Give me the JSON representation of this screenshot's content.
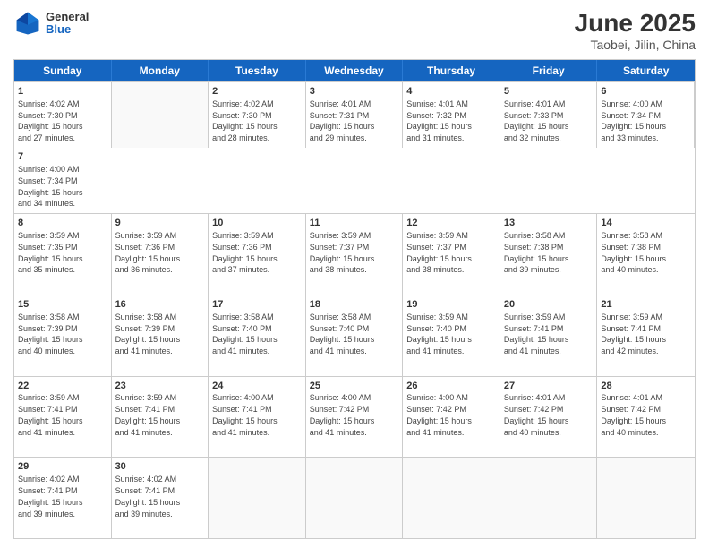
{
  "header": {
    "logo_general": "General",
    "logo_blue": "Blue",
    "month_title": "June 2025",
    "location": "Taobei, Jilin, China"
  },
  "weekdays": [
    "Sunday",
    "Monday",
    "Tuesday",
    "Wednesday",
    "Thursday",
    "Friday",
    "Saturday"
  ],
  "rows": [
    [
      {
        "empty": true
      },
      {
        "day": "2",
        "info": "Sunrise: 4:02 AM\nSunset: 7:30 PM\nDaylight: 15 hours\nand 28 minutes."
      },
      {
        "day": "3",
        "info": "Sunrise: 4:01 AM\nSunset: 7:31 PM\nDaylight: 15 hours\nand 29 minutes."
      },
      {
        "day": "4",
        "info": "Sunrise: 4:01 AM\nSunset: 7:32 PM\nDaylight: 15 hours\nand 31 minutes."
      },
      {
        "day": "5",
        "info": "Sunrise: 4:01 AM\nSunset: 7:33 PM\nDaylight: 15 hours\nand 32 minutes."
      },
      {
        "day": "6",
        "info": "Sunrise: 4:00 AM\nSunset: 7:34 PM\nDaylight: 15 hours\nand 33 minutes."
      },
      {
        "day": "7",
        "info": "Sunrise: 4:00 AM\nSunset: 7:34 PM\nDaylight: 15 hours\nand 34 minutes."
      }
    ],
    [
      {
        "day": "8",
        "info": "Sunrise: 3:59 AM\nSunset: 7:35 PM\nDaylight: 15 hours\nand 35 minutes."
      },
      {
        "day": "9",
        "info": "Sunrise: 3:59 AM\nSunset: 7:36 PM\nDaylight: 15 hours\nand 36 minutes."
      },
      {
        "day": "10",
        "info": "Sunrise: 3:59 AM\nSunset: 7:36 PM\nDaylight: 15 hours\nand 37 minutes."
      },
      {
        "day": "11",
        "info": "Sunrise: 3:59 AM\nSunset: 7:37 PM\nDaylight: 15 hours\nand 38 minutes."
      },
      {
        "day": "12",
        "info": "Sunrise: 3:59 AM\nSunset: 7:37 PM\nDaylight: 15 hours\nand 38 minutes."
      },
      {
        "day": "13",
        "info": "Sunrise: 3:58 AM\nSunset: 7:38 PM\nDaylight: 15 hours\nand 39 minutes."
      },
      {
        "day": "14",
        "info": "Sunrise: 3:58 AM\nSunset: 7:38 PM\nDaylight: 15 hours\nand 40 minutes."
      }
    ],
    [
      {
        "day": "15",
        "info": "Sunrise: 3:58 AM\nSunset: 7:39 PM\nDaylight: 15 hours\nand 40 minutes."
      },
      {
        "day": "16",
        "info": "Sunrise: 3:58 AM\nSunset: 7:39 PM\nDaylight: 15 hours\nand 41 minutes."
      },
      {
        "day": "17",
        "info": "Sunrise: 3:58 AM\nSunset: 7:40 PM\nDaylight: 15 hours\nand 41 minutes."
      },
      {
        "day": "18",
        "info": "Sunrise: 3:58 AM\nSunset: 7:40 PM\nDaylight: 15 hours\nand 41 minutes."
      },
      {
        "day": "19",
        "info": "Sunrise: 3:59 AM\nSunset: 7:40 PM\nDaylight: 15 hours\nand 41 minutes."
      },
      {
        "day": "20",
        "info": "Sunrise: 3:59 AM\nSunset: 7:41 PM\nDaylight: 15 hours\nand 41 minutes."
      },
      {
        "day": "21",
        "info": "Sunrise: 3:59 AM\nSunset: 7:41 PM\nDaylight: 15 hours\nand 42 minutes."
      }
    ],
    [
      {
        "day": "22",
        "info": "Sunrise: 3:59 AM\nSunset: 7:41 PM\nDaylight: 15 hours\nand 41 minutes."
      },
      {
        "day": "23",
        "info": "Sunrise: 3:59 AM\nSunset: 7:41 PM\nDaylight: 15 hours\nand 41 minutes."
      },
      {
        "day": "24",
        "info": "Sunrise: 4:00 AM\nSunset: 7:41 PM\nDaylight: 15 hours\nand 41 minutes."
      },
      {
        "day": "25",
        "info": "Sunrise: 4:00 AM\nSunset: 7:42 PM\nDaylight: 15 hours\nand 41 minutes."
      },
      {
        "day": "26",
        "info": "Sunrise: 4:00 AM\nSunset: 7:42 PM\nDaylight: 15 hours\nand 41 minutes."
      },
      {
        "day": "27",
        "info": "Sunrise: 4:01 AM\nSunset: 7:42 PM\nDaylight: 15 hours\nand 40 minutes."
      },
      {
        "day": "28",
        "info": "Sunrise: 4:01 AM\nSunset: 7:42 PM\nDaylight: 15 hours\nand 40 minutes."
      }
    ],
    [
      {
        "day": "29",
        "info": "Sunrise: 4:02 AM\nSunset: 7:41 PM\nDaylight: 15 hours\nand 39 minutes."
      },
      {
        "day": "30",
        "info": "Sunrise: 4:02 AM\nSunset: 7:41 PM\nDaylight: 15 hours\nand 39 minutes."
      },
      {
        "empty": true
      },
      {
        "empty": true
      },
      {
        "empty": true
      },
      {
        "empty": true
      },
      {
        "empty": true
      }
    ]
  ],
  "row0_day1": {
    "day": "1",
    "info": "Sunrise: 4:02 AM\nSunset: 7:30 PM\nDaylight: 15 hours\nand 27 minutes."
  }
}
